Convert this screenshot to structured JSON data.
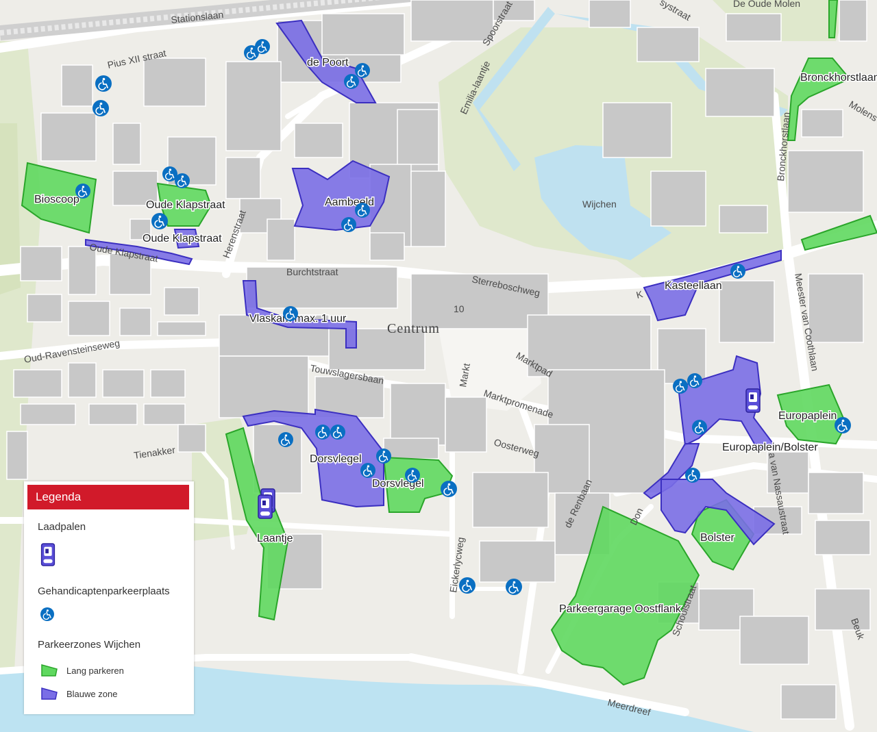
{
  "map": {
    "place_labels": {
      "centrum": "Centrum",
      "oude_molen": "De Oude Molen",
      "wijchen": "Wijchen"
    },
    "streets": {
      "stationslaan": "Stationslaan",
      "pius": "Pius XII straat",
      "spoorstraat": "Spoorstraat",
      "emilia": "Emilia-laantje",
      "herenstraat": "Herenstraat",
      "oude_klapstraat": "Oude Klapstraat",
      "burchtstraat": "Burchtstraat",
      "sterreboschweg": "Sterreboschweg",
      "oud_ravensteinseweg": "Oud-Ravensteinseweg",
      "touwslagersbaan": "Touwslagersbaan",
      "markt": "Markt",
      "marktpad": "Marktpad",
      "marktpromenade": "Marktpromenade",
      "oosterweg": "Oosterweg",
      "tienakker": "Tienakker",
      "de_renbaan": "de Renbaan",
      "eickerlycweg": "Eickerlycweg",
      "don_bosco": "Don",
      "schoolstraat": "Schoolstraat",
      "meerdreef": "Meerdreef",
      "bronckhorstlaan": "Bronckhorstlaan",
      "molenstraat": "Molens",
      "meester_van_coothlaan": "Meester van Coothlaan",
      "van_nassaustraat": "a van Nassaustraat",
      "kasteellaan_small": "K",
      "europaplein_small": "Europaplein",
      "aambeeld_small": "Aambeeld",
      "beuk": "Beuk",
      "laantje_small": "Laantje",
      "dorsvlegel_small": "Dorsvlegel",
      "bolster_small": "Bolster",
      "ten": "10",
      "systraat": "systraat"
    },
    "zone_labels": {
      "de_poort": "de Poort",
      "bioscoop": "Bioscoop",
      "oude_klapstraat_1": "Oude Klapstraat",
      "oude_klapstraat_2": "Oude Klapstraat",
      "aambeeld": "Aambeeld",
      "vlaskam": "Vlaskam max. 1 uur",
      "kasteellaan": "Kasteellaan",
      "europaplein": "Europaplein",
      "europaplein_bolster": "Europaplein/Bolster",
      "bolster": "Bolster",
      "dorsvlegel_1": "Dorsvlegel",
      "dorsvlegel_2": "Dorsvlegel",
      "laantje": "Laantje",
      "parkeergarage": "Parkeergarage Oostflank",
      "bronckhorstlaan": "Bronckhorstlaan"
    },
    "colors": {
      "lang_parkeren": "#5fd85f",
      "blauwe_zone": "#7a6ee6",
      "zone_stroke_blue": "#3b2fc0",
      "zone_stroke_green": "#2aa52a",
      "icon_blue": "#0a6fc2",
      "water": "#bde3f2",
      "park": "#dfe8cc",
      "building": "#c9c9c9",
      "road": "#ffffff"
    }
  },
  "legend": {
    "title": "Legenda",
    "laadpalen": "Laadpalen",
    "gehandicapten": "Gehandicaptenparkeerplaats",
    "parkeerzones": "Parkeerzones Wijchen",
    "lang_parkeren": "Lang parkeren",
    "blauwe_zone": "Blauwe zone"
  }
}
